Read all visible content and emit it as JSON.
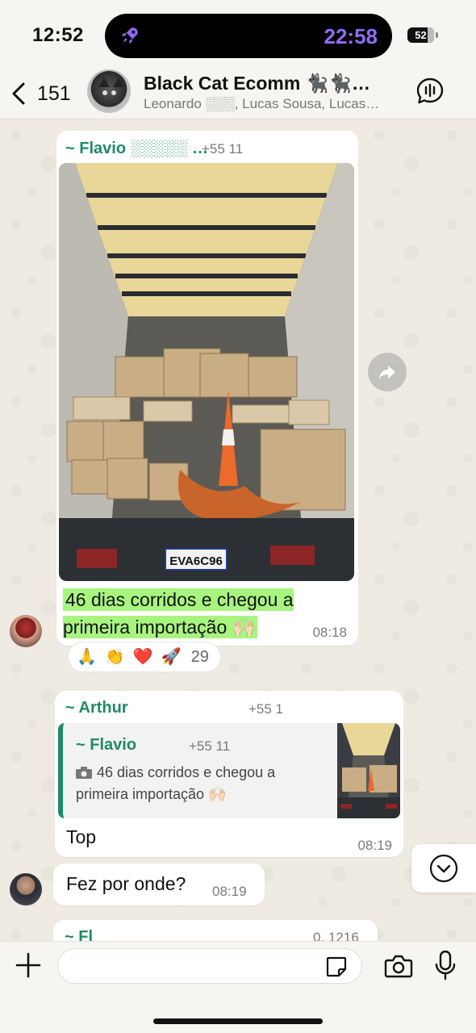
{
  "status_bar": {
    "time": "12:52",
    "live_activity_time": "22:58",
    "battery_level": "52",
    "rocket_icon": "rocket-icon"
  },
  "header": {
    "back_count": "151",
    "title": "Black Cat Ecomm 🐈‍⬛🐈‍⬛…",
    "subtitle": "Leonardo ░░░, Lucas Sousa, Lucas…",
    "voice_chat_icon": "voice-chat-icon"
  },
  "messages": [
    {
      "sender": "~ Flavio ░░░░░ …",
      "phone": "+55 11",
      "caption": "46 dias corridos e chegou a primeira importação 🙌🏻",
      "time": "08:18",
      "plate": "EVA6C96",
      "reactions": [
        "🙏",
        "👏",
        "❤️",
        "🚀"
      ],
      "reaction_count": "29"
    },
    {
      "sender": "~ Arthur",
      "phone": "+55 1",
      "quote_sender": "~ Flavio",
      "quote_phone": "+55 11",
      "quote_text": "46 dias corridos e chegou a primeira importação 🙌🏻",
      "text": "Top",
      "time": "08:19"
    },
    {
      "text": "Fez por onde?",
      "time": "08:19"
    },
    {
      "sender": "~ Fl",
      "phone": "0. 1216"
    }
  ],
  "composer": {
    "placeholder": ""
  },
  "colors": {
    "sender_green": "#1f8a67",
    "highlight": "#a7f47f",
    "live_activity_purple": "#8f6cf3"
  }
}
